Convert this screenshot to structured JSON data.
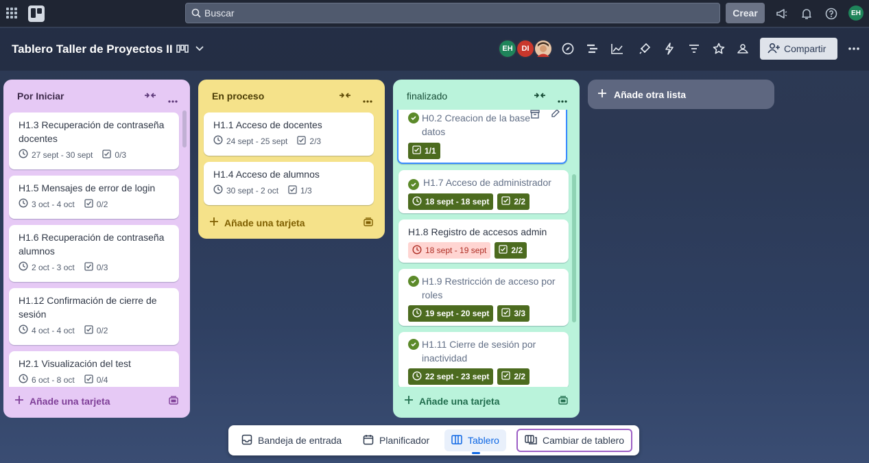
{
  "topbar": {
    "search_placeholder": "Buscar",
    "create_label": "Crear",
    "user_initials": "EH"
  },
  "board": {
    "title": "Tablero Taller de Proyectos II",
    "members": [
      {
        "initials": "EH",
        "color": "#1f845a"
      },
      {
        "initials": "DI",
        "color": "#c9372c"
      },
      {
        "initials": "",
        "color": "#b0603b"
      }
    ],
    "share_label": "Compartir"
  },
  "lists": [
    {
      "title": "Por Iniciar",
      "bg": "#e6c9f5",
      "accent": "#7f3f98",
      "cards": [
        {
          "title": "H1.3 Recuperación de contraseña docentes",
          "dates": "27 sept - 30 sept",
          "checklist": "0/3"
        },
        {
          "title": "H1.5 Mensajes de error de login",
          "dates": "3 oct - 4 oct",
          "checklist": "0/2"
        },
        {
          "title": "H1.6 Recuperación de contraseña alumnos",
          "dates": "2 oct - 3 oct",
          "checklist": "0/3"
        },
        {
          "title": "H1.12 Confirmación de cierre de sesión",
          "dates": "4 oct - 4 oct",
          "checklist": "0/2"
        },
        {
          "title": "H2.1 Visualización del test",
          "dates": "6 oct - 8 oct",
          "checklist": "0/4"
        }
      ],
      "add_label": "Añade una tarjeta"
    },
    {
      "title": "En proceso",
      "bg": "#f5e28a",
      "accent": "#7f5f01",
      "cards": [
        {
          "title": "H1.1 Acceso de docentes",
          "dates": "24 sept - 25 sept",
          "checklist": "2/3"
        },
        {
          "title": "H1.4 Acceso de alumnos",
          "dates": "30 sept - 2 oct",
          "checklist": "1/3"
        }
      ],
      "add_label": "Añade una tarjeta"
    },
    {
      "title": "finalizado",
      "bg": "#baf3db",
      "accent": "#216e4e",
      "cards": [
        {
          "title": "H0.2 Creacion de la base datos",
          "dates": "",
          "checklist": "1/1",
          "done": true
        },
        {
          "title": "H1.7 Acceso de administrador",
          "dates": "18 sept - 18 sept",
          "checklist": "2/2",
          "done": true
        },
        {
          "title": "H1.8 Registro de accesos admin",
          "dates": "18 sept - 19 sept",
          "checklist": "2/2",
          "overdue": true
        },
        {
          "title": "H1.9 Restricción de acceso por roles",
          "dates": "19 sept - 20 sept",
          "checklist": "3/3",
          "done": true
        },
        {
          "title": "H1.11 Cierre de sesión por inactividad",
          "dates": "22 sept - 23 sept",
          "checklist": "2/2",
          "done": true
        }
      ],
      "add_label": "Añade una tarjeta"
    }
  ],
  "add_list_label": "Añade otra lista",
  "bottom_nav": {
    "inbox": "Bandeja de entrada",
    "planner": "Planificador",
    "board": "Tablero",
    "switch": "Cambiar de tablero"
  }
}
